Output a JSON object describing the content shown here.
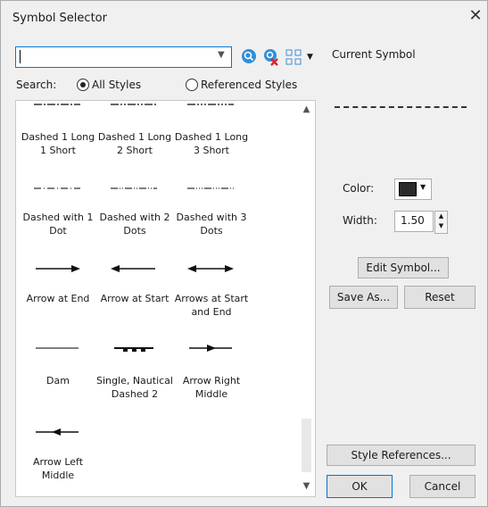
{
  "window": {
    "title": "Symbol Selector",
    "close_glyph": "✕"
  },
  "search": {
    "value": "",
    "label": "Search:",
    "scope_all": "All Styles",
    "scope_referenced": "Referenced Styles",
    "selected_scope": "All Styles"
  },
  "toolbar": {
    "search_icon": "search-icon",
    "clear_icon": "clear-search-icon",
    "view_icon": "grid-view-icon"
  },
  "symbols": [
    {
      "label": "Dashed 1 Long 1 Short",
      "line1": "Dashed 1 Long",
      "line2": "1 Short",
      "style": "dash-1long-1short"
    },
    {
      "label": "Dashed 1 Long 2 Short",
      "line1": "Dashed 1 Long",
      "line2": "2 Short",
      "style": "dash-1long-2short"
    },
    {
      "label": "Dashed 1 Long 3 Short",
      "line1": "Dashed 1 Long",
      "line2": "3 Short",
      "style": "dash-1long-3short"
    },
    {
      "label": "Dashed with 1 Dot",
      "line1": "Dashed with 1",
      "line2": "Dot",
      "style": "dash-1dot"
    },
    {
      "label": "Dashed with 2 Dots",
      "line1": "Dashed with 2",
      "line2": "Dots",
      "style": "dash-2dots"
    },
    {
      "label": "Dashed with 3 Dots",
      "line1": "Dashed with 3",
      "line2": "Dots",
      "style": "dash-3dots"
    },
    {
      "label": "Arrow at End",
      "line1": "Arrow at End",
      "line2": "",
      "style": "arrow-end"
    },
    {
      "label": "Arrow at Start",
      "line1": "Arrow at Start",
      "line2": "",
      "style": "arrow-start"
    },
    {
      "label": "Arrows at Start and End",
      "line1": "Arrows at Start",
      "line2": "and End",
      "style": "arrow-both"
    },
    {
      "label": "Dam",
      "line1": "Dam",
      "line2": "",
      "style": "dam"
    },
    {
      "label": "Single, Nautical Dashed 2",
      "line1": "Single, Nautical",
      "line2": "Dashed 2",
      "style": "nautical"
    },
    {
      "label": "Arrow Right Middle",
      "line1": "Arrow Right",
      "line2": "Middle",
      "style": "arrow-right-middle"
    },
    {
      "label": "Arrow Left Middle",
      "line1": "Arrow Left",
      "line2": "Middle",
      "style": "arrow-left-middle"
    }
  ],
  "current_symbol": {
    "heading": "Current Symbol",
    "color_label": "Color:",
    "color_value": "#2b2b2b",
    "width_label": "Width:",
    "width_value": "1.50"
  },
  "buttons": {
    "edit_symbol": "Edit Symbol...",
    "save_as": "Save As...",
    "reset": "Reset",
    "style_references": "Style References...",
    "ok": "OK",
    "cancel": "Cancel"
  }
}
